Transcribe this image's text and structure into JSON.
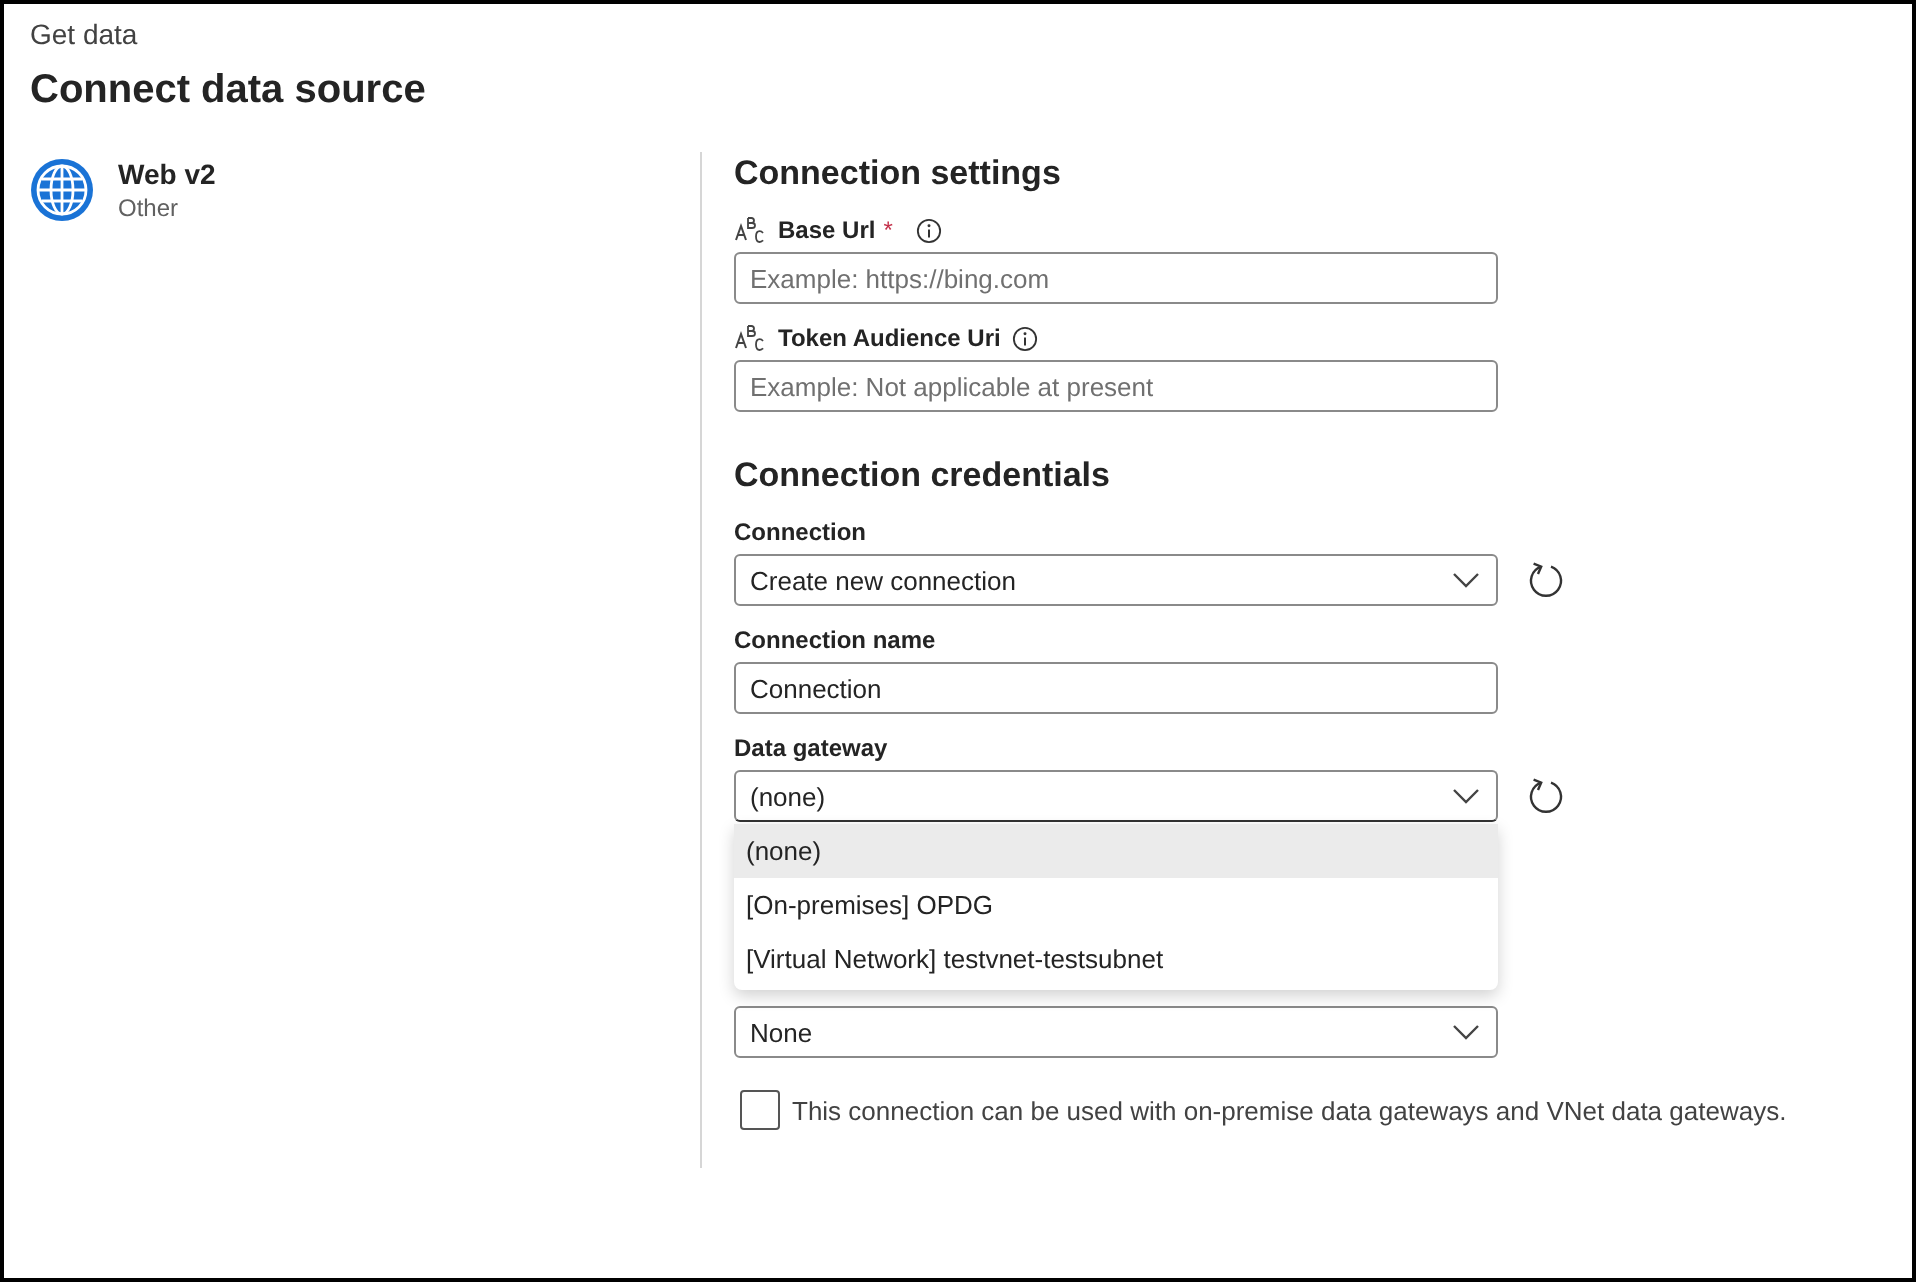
{
  "header": {
    "breadcrumb": "Get data",
    "title": "Connect data source"
  },
  "source": {
    "name": "Web v2",
    "category": "Other"
  },
  "settings": {
    "heading": "Connection settings",
    "fields": [
      {
        "label": "Base Url",
        "required_mark": "*",
        "placeholder": "Example: https://bing.com"
      },
      {
        "label": "Token Audience Uri",
        "placeholder": "Example: Not applicable at present"
      }
    ]
  },
  "credentials": {
    "heading": "Connection credentials",
    "fields": [
      {
        "kind": "select",
        "label": "Connection",
        "value": "Create new connection",
        "refresh": true,
        "expanded": false
      },
      {
        "kind": "text",
        "label": "Connection name",
        "value": "Connection"
      },
      {
        "kind": "select",
        "label": "Data gateway",
        "value": "(none)",
        "refresh": true,
        "expanded": true,
        "options": [
          {
            "label": "(none)",
            "selected": true
          },
          {
            "label": "[On-premises] OPDG",
            "selected": false
          },
          {
            "label": "[Virtual Network] testvnet-testsubnet",
            "selected": false
          }
        ]
      },
      {
        "kind": "select",
        "value": "None",
        "refresh": false,
        "expanded": false
      }
    ],
    "checkbox": {
      "label": "This connection can be used with on-premise data gateways and VNet data gateways.",
      "checked": false
    }
  }
}
